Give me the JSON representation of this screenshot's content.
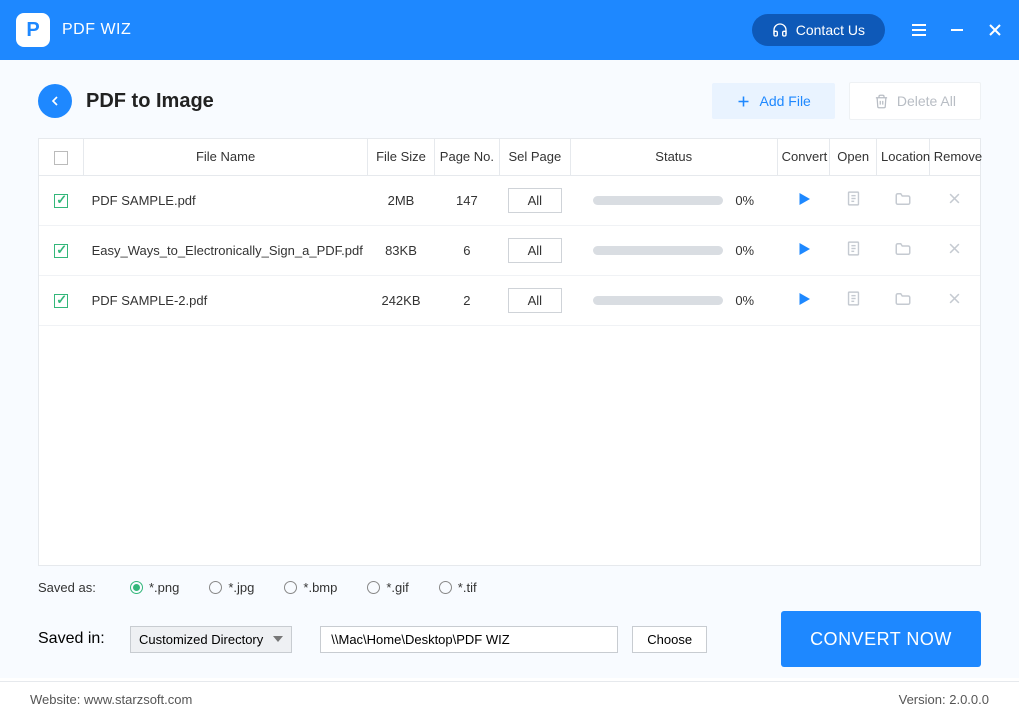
{
  "header": {
    "app_name": "PDF WIZ",
    "contact_label": "Contact Us"
  },
  "page": {
    "title": "PDF to Image",
    "add_file_label": "Add File",
    "delete_all_label": "Delete All"
  },
  "table": {
    "headers": {
      "file_name": "File Name",
      "file_size": "File Size",
      "page_no": "Page No.",
      "sel_page": "Sel Page",
      "status": "Status",
      "convert": "Convert",
      "open": "Open",
      "location": "Location",
      "remove": "Remove"
    },
    "rows": [
      {
        "checked": true,
        "name": "PDF SAMPLE.pdf",
        "size": "2MB",
        "page_no": "147",
        "sel_page": "All",
        "status_pct": "0%"
      },
      {
        "checked": true,
        "name": "Easy_Ways_to_Electronically_Sign_a_PDF.pdf",
        "size": "83KB",
        "page_no": "6",
        "sel_page": "All",
        "status_pct": "0%"
      },
      {
        "checked": true,
        "name": "PDF SAMPLE-2.pdf",
        "size": "242KB",
        "page_no": "2",
        "sel_page": "All",
        "status_pct": "0%"
      }
    ]
  },
  "saved_as": {
    "label": "Saved as:",
    "options": [
      "*.png",
      "*.jpg",
      "*.bmp",
      "*.gif",
      "*.tif"
    ],
    "selected_index": 0
  },
  "saved_in": {
    "label": "Saved in:",
    "mode": "Customized Directory",
    "path": "\\\\Mac\\Home\\Desktop\\PDF WIZ",
    "choose_label": "Choose"
  },
  "convert_now_label": "CONVERT NOW",
  "footer": {
    "website_label": "Website:",
    "website_value": "www.starzsoft.com",
    "version_label": "Version:",
    "version_value": "2.0.0.0"
  }
}
